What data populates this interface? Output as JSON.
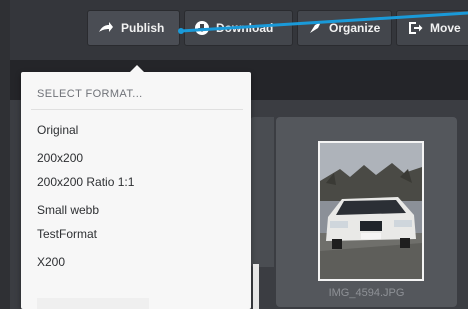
{
  "toolbar": {
    "publish_label": "Publish",
    "download_label": "Download",
    "organize_label": "Organize",
    "move_label": "Move"
  },
  "format_menu": {
    "header": "SELECT FORMAT...",
    "items": [
      "Original",
      "200x200",
      "200x200 Ratio 1:1",
      "Small webb",
      "TestFormat",
      "X200"
    ]
  },
  "asset": {
    "filename": "IMG_4594.JPG"
  },
  "icons": {
    "publish": "arrow-right-icon",
    "download": "download-icon",
    "organize": "tag-icon",
    "move": "move-icon"
  },
  "colors": {
    "annotation_line": "#1a9ad9",
    "toolbar_bg": "#34363b",
    "dropdown_bg": "#f7f7f7"
  }
}
